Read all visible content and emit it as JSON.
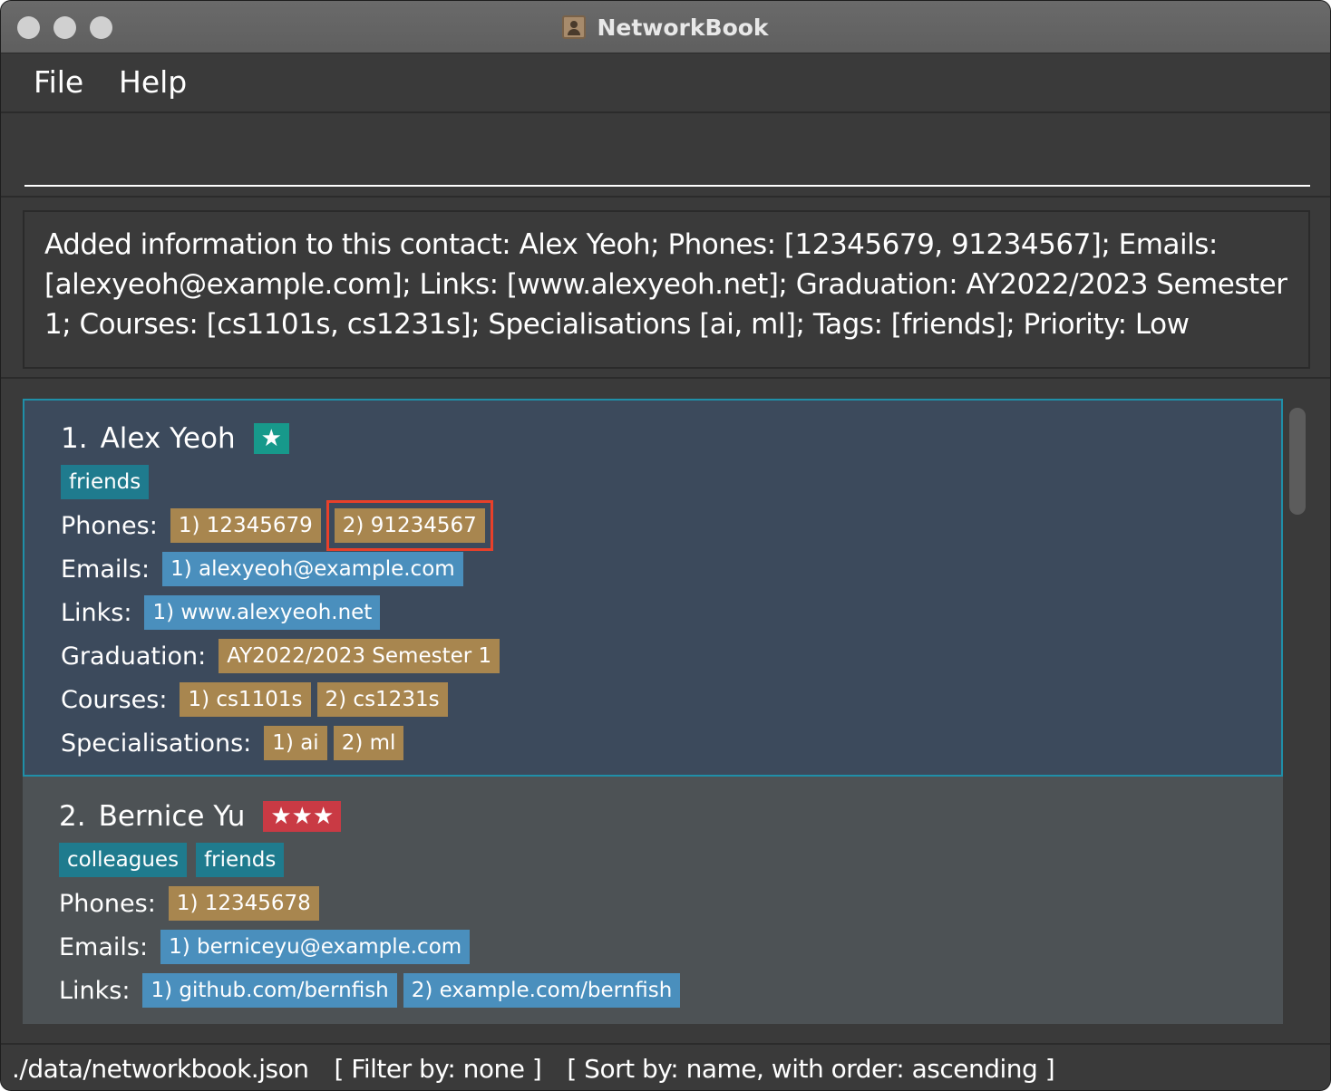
{
  "window": {
    "title": "NetworkBook",
    "icon": "contact-book-icon"
  },
  "menu": {
    "file": "File",
    "help": "Help"
  },
  "command": {
    "value": "",
    "placeholder": ""
  },
  "result": {
    "message": "Added information to this contact: Alex Yeoh; Phones: [12345679, 91234567]; Emails: [alexyeoh@example.com]; Links: [www.alexyeoh.net]; Graduation: AY2022/2023 Semester 1; Courses: [cs1101s, cs1231s]; Specialisations [ai, ml]; Tags: [friends]; Priority: Low"
  },
  "labels": {
    "phones": "Phones:",
    "emails": "Emails:",
    "links": "Links:",
    "graduation": "Graduation:",
    "courses": "Courses:",
    "specialisations": "Specialisations:"
  },
  "contacts": [
    {
      "index": "1.",
      "name": "Alex Yeoh",
      "priority_stars": "★",
      "tags": [
        "friends"
      ],
      "phones": [
        "1) 12345679",
        "2) 91234567"
      ],
      "emails": [
        "1) alexyeoh@example.com"
      ],
      "links": [
        "1) www.alexyeoh.net"
      ],
      "graduation": "AY2022/2023 Semester 1",
      "courses": [
        "1) cs1101s",
        "2) cs1231s"
      ],
      "specialisations": [
        "1) ai",
        "2) ml"
      ]
    },
    {
      "index": "2.",
      "name": "Bernice Yu",
      "priority_stars": "★★★",
      "tags": [
        "colleagues",
        "friends"
      ],
      "phones": [
        "1) 12345678"
      ],
      "emails": [
        "1) berniceyu@example.com"
      ],
      "links": [
        "1) github.com/bernfish",
        "2) example.com/bernfish"
      ]
    }
  ],
  "status": {
    "file_path": "./data/networkbook.json",
    "filter": "[ Filter by: none ]",
    "sort": "[ Sort by: name, with order: ascending ]"
  },
  "colors": {
    "chip_brown": "#a8864f",
    "chip_blue": "#4a8fbd",
    "tag_teal": "#1f7b8e",
    "selected_card": "#3c4a5c",
    "highlight_box": "#e8402a"
  }
}
